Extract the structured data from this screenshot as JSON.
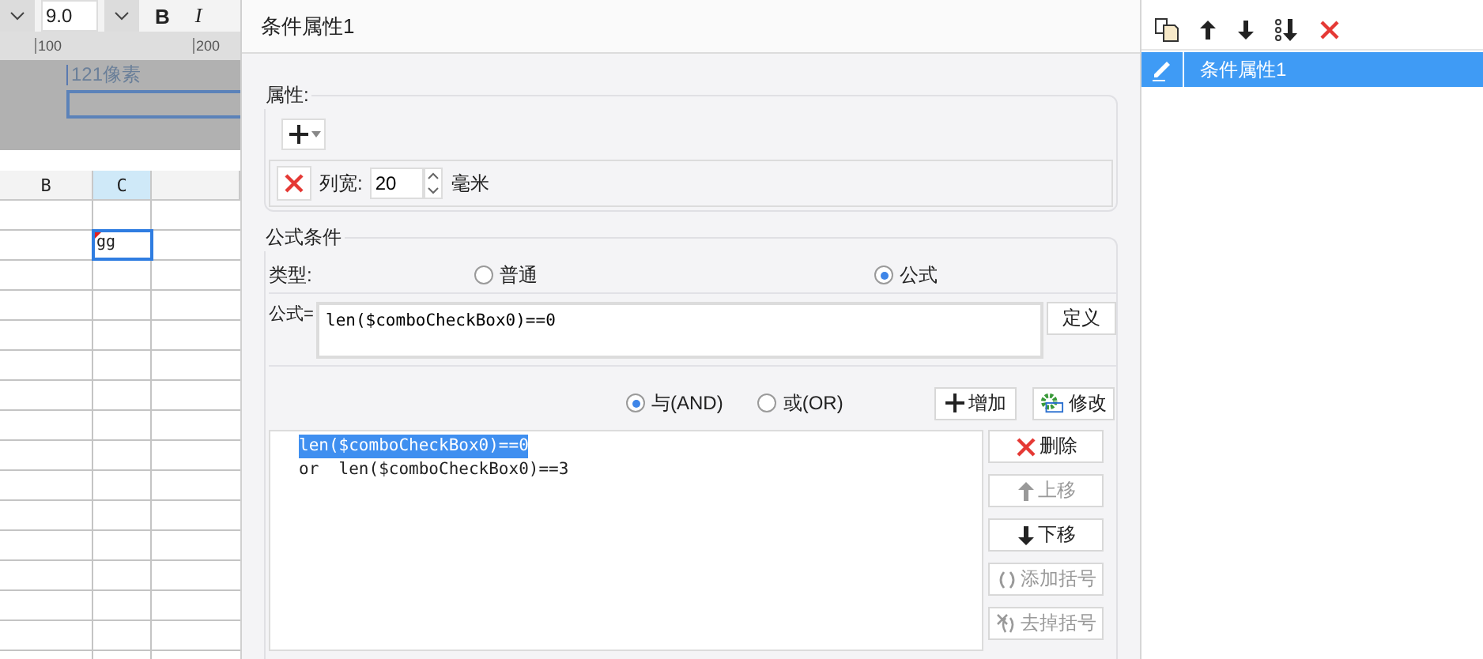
{
  "sheet_toolbar": {
    "font_size": "9.0",
    "bold": "B",
    "italic": "I"
  },
  "ruler": {
    "ticks": [
      "100",
      "200"
    ]
  },
  "design_area": {
    "size_label": "121像素"
  },
  "sheet": {
    "columns": [
      {
        "label": "B",
        "selected": false
      },
      {
        "label": "C",
        "selected": true
      }
    ],
    "active_cell": {
      "text": "gg"
    }
  },
  "dialog": {
    "title": "条件属性1",
    "properties": {
      "legend": "属性:",
      "column_width": {
        "label": "列宽:",
        "value": "20",
        "unit": "毫米"
      }
    },
    "formula_condition": {
      "legend": "公式条件",
      "type_label": "类型:",
      "types": [
        {
          "label": "普通",
          "selected": false
        },
        {
          "label": "公式",
          "selected": true
        }
      ],
      "formula_label": "公式=",
      "formula": "len($comboCheckBox0)==0",
      "define_button": "定义",
      "joins": [
        {
          "label": "与(AND)",
          "selected": true
        },
        {
          "label": "或(OR)",
          "selected": false
        }
      ],
      "add_button": "增加",
      "modify_button": "修改",
      "conditions": [
        {
          "text": "len($comboCheckBox0)==0",
          "selected": true
        },
        {
          "text": "or  len($comboCheckBox0)==3",
          "selected": false
        }
      ],
      "actions": [
        {
          "label": "删除",
          "kind": "delete",
          "disabled": false
        },
        {
          "label": "上移",
          "kind": "up",
          "disabled": true
        },
        {
          "label": "下移",
          "kind": "down",
          "disabled": false
        },
        {
          "label": "添加括号",
          "kind": "add-brackets",
          "disabled": true
        },
        {
          "label": "去掉括号",
          "kind": "remove-brackets",
          "disabled": true
        }
      ]
    }
  },
  "side_panel": {
    "items": [
      {
        "label": "条件属性1",
        "selected": true
      }
    ]
  }
}
